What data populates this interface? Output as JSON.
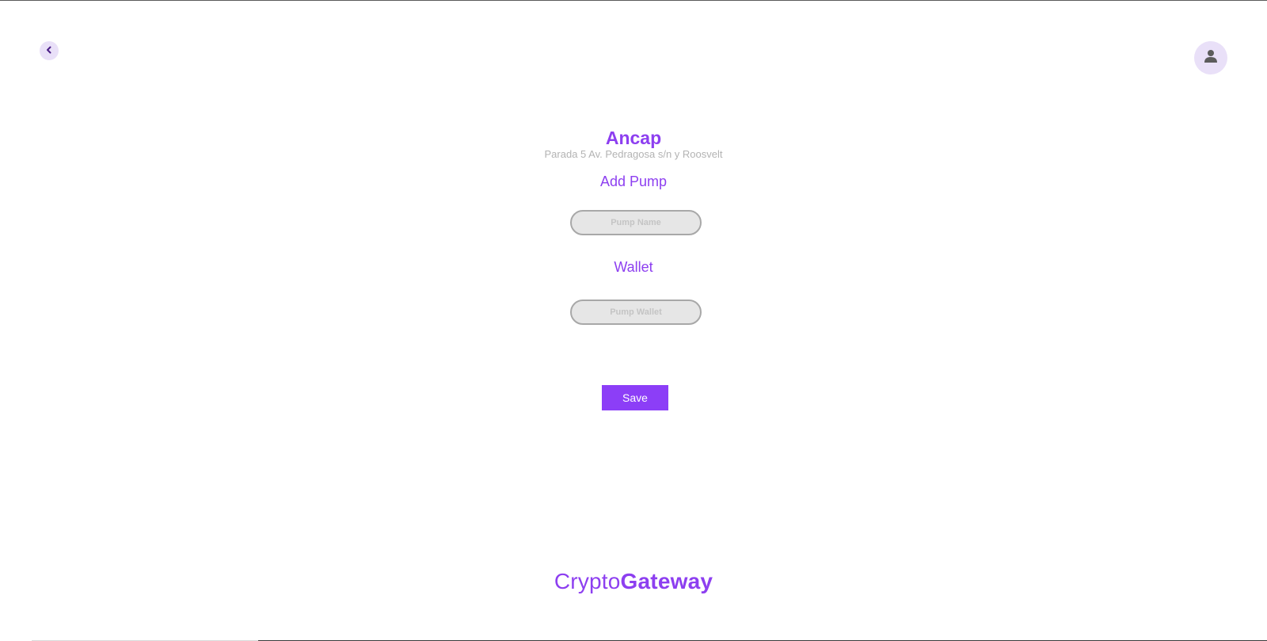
{
  "header": {
    "back_icon": "chevron-left-icon",
    "avatar_icon": "user-icon"
  },
  "station": {
    "name": "Ancap",
    "address": "Parada 5 Av. Pedragosa s/n y Roosvelt"
  },
  "form": {
    "add_pump_heading": "Add Pump",
    "pump_name_placeholder": "Pump Name",
    "pump_name_value": "",
    "wallet_heading": "Wallet",
    "pump_wallet_placeholder": "Pump Wallet",
    "pump_wallet_value": "",
    "save_label": "Save"
  },
  "footer": {
    "brand_light": "Crypto",
    "brand_bold": "Gateway"
  },
  "colors": {
    "accent": "#8d3ff0",
    "button": "#8c3ef7",
    "icon_bg": "#e9e0f8",
    "muted_text": "#b3b3b3",
    "input_bg": "#e6e6e6"
  }
}
